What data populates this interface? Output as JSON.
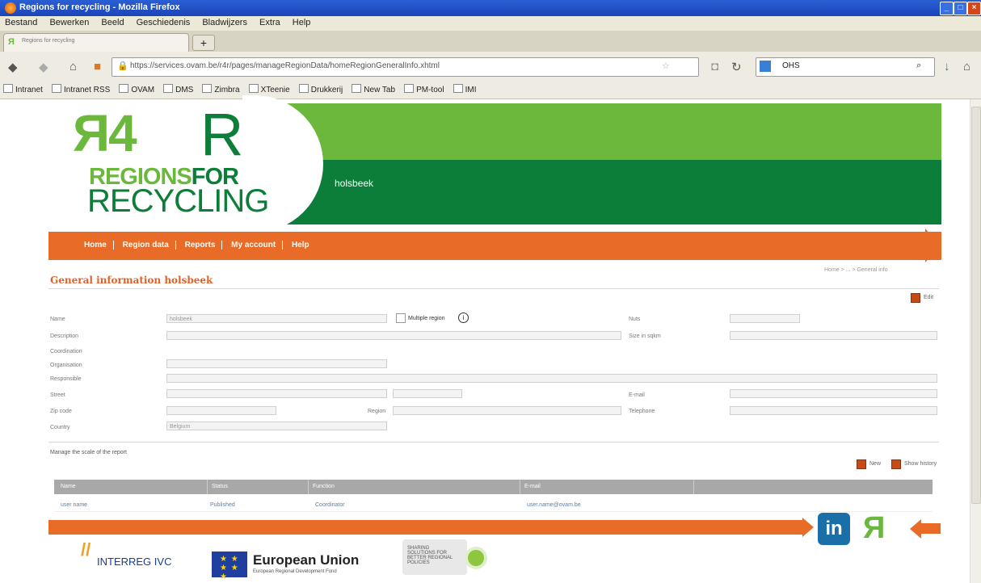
{
  "window": {
    "title": "Regions for recycling - Mozilla Firefox",
    "min": "_",
    "max": "□",
    "close": "×"
  },
  "menubar": [
    "Bestand",
    "Bewerken",
    "Beeld",
    "Geschiedenis",
    "Bladwijzers",
    "Extra",
    "Help"
  ],
  "tab": {
    "label": "Regions for recycling",
    "new_tab": "+"
  },
  "nav": {
    "url": "https://services.ovam.be/r4r/pages/manageRegionData/homeRegionGeneralInfo.xhtml",
    "search_value": "OHS"
  },
  "bookmarks": [
    "Intranet",
    "Intranet RSS",
    "OVAM",
    "DMS",
    "Zimbra",
    "XTeenie",
    "Drukkerij",
    "New Tab",
    "PM-tool",
    "IMI"
  ],
  "banner": {
    "logo_mark": "Я4",
    "logo_r": "R",
    "logo_regions": "REGIONS",
    "logo_for": "FOR",
    "logo_recycling": "RECYCLING",
    "region_name": "holsbeek"
  },
  "main_menu": [
    "Home",
    "Region data",
    "Reports",
    "My account",
    "Help"
  ],
  "breadcrumb": "Home > ... > General info",
  "page_title": "General information holsbeek",
  "actions": {
    "edit": "Edit",
    "new": "New",
    "show_history": "Show history"
  },
  "form": {
    "labels": {
      "name": "Name",
      "description": "Description",
      "coordination": "Coordination",
      "organisation": "Organisation",
      "responsible": "Responsible",
      "street": "Street",
      "zip_code": "Zip code",
      "country": "Country",
      "nuts": "Nuts",
      "size": "Size in sqkm",
      "email": "E-mail",
      "place": "Region",
      "telephone": "Telephone"
    },
    "values": {
      "name": "holsbeek",
      "description": "",
      "organisation": "",
      "country": "Belgium",
      "size": ""
    },
    "multiple_region": "Multiple region"
  },
  "scale_text": "Manage the scale of the report",
  "table": {
    "headers": [
      "Name",
      "Status",
      "Function",
      "E-mail"
    ],
    "rows": [
      [
        "user name",
        "Published",
        "Coordinator",
        "user.name@ovam.be"
      ]
    ]
  },
  "footer": {
    "linkedin": "in",
    "logo": "Я",
    "interreg": "INTERREG IVC",
    "eu_title": "European Union",
    "eu_sub": "European Regional Development Fund",
    "badge": "SHARING SOLUTIONS FOR BETTER REGIONAL POLICIES",
    "stars": "★ ★ ★ ★ ★"
  },
  "colors": {
    "green_light": "#6cb83c",
    "green_dark": "#0d7e3a",
    "orange": "#e86b28",
    "title_orange": "#e0622a"
  }
}
